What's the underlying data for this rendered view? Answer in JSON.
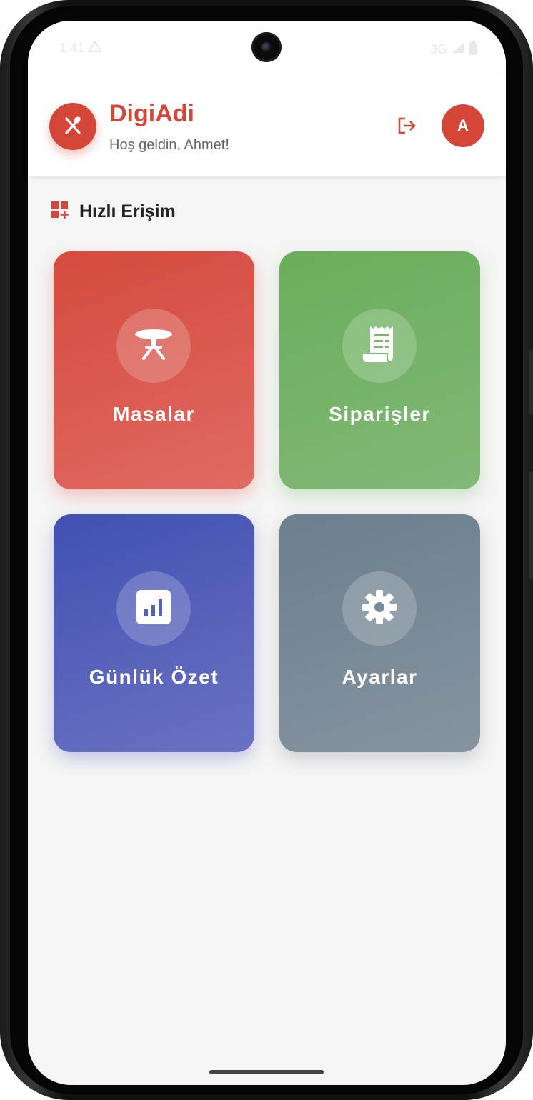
{
  "status_bar": {
    "time": "1:41",
    "network": "3G"
  },
  "app_bar": {
    "title": "DigiAdi",
    "subtitle": "Hoş geldin, Ahmet!",
    "avatar_initial": "A"
  },
  "quick_access": {
    "title": "Hızlı Erişim",
    "tiles": [
      {
        "label": "Masalar",
        "icon": "table-icon",
        "color": "#d54a3e"
      },
      {
        "label": "Siparişler",
        "icon": "receipt-icon",
        "color": "#69ae5b"
      },
      {
        "label": "Günlük Özet",
        "icon": "bar-chart-icon",
        "color": "#4150b2"
      },
      {
        "label": "Ayarlar",
        "icon": "gear-icon",
        "color": "#6b7f8e"
      }
    ]
  },
  "colors": {
    "brand": "#d44638",
    "background": "#f5f5f5"
  }
}
